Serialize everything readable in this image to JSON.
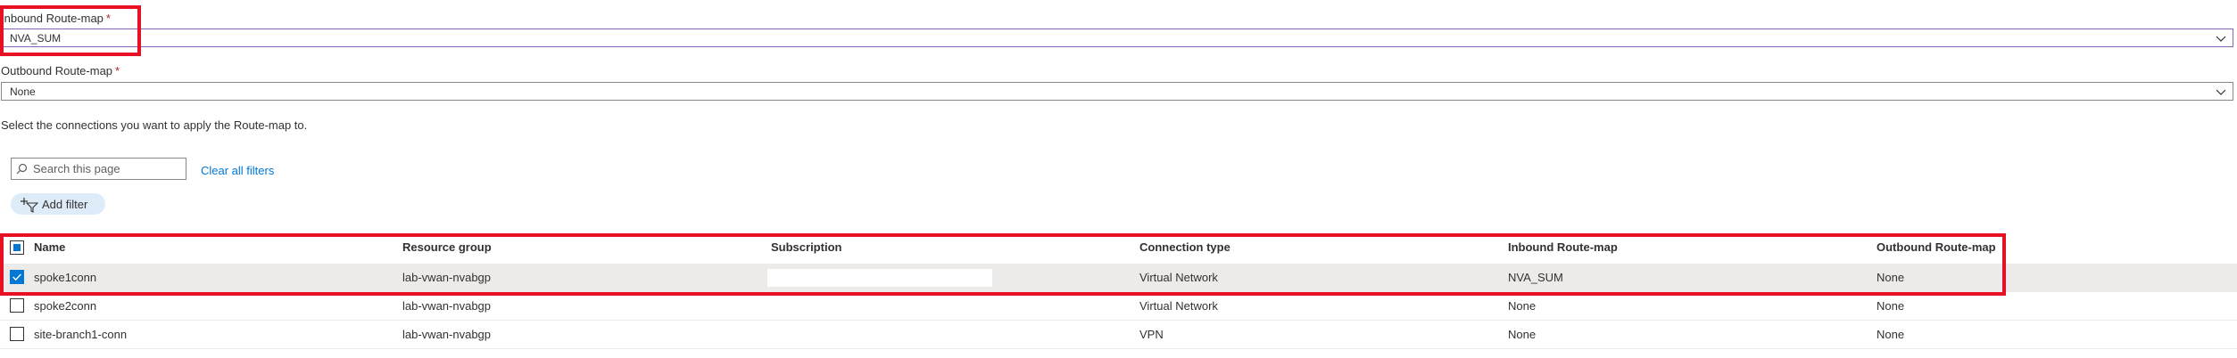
{
  "inbound": {
    "label": "Inbound Route-map",
    "required_mark": "*",
    "value": "NVA_SUM"
  },
  "outbound": {
    "label": "Outbound Route-map",
    "required_mark": "*",
    "value": "None"
  },
  "instructions": "Select the connections you want to apply the Route-map to.",
  "search": {
    "placeholder": "Search this page"
  },
  "clear_filters_label": "Clear all filters",
  "add_filter_label": "Add filter",
  "columns": [
    "Name",
    "Resource group",
    "Subscription",
    "Connection type",
    "Inbound Route-map",
    "Outbound Route-map"
  ],
  "rows": [
    {
      "selected": true,
      "name": "spoke1conn",
      "resource_group": "lab-vwan-nvabgp",
      "subscription": "",
      "connection_type": "Virtual Network",
      "inbound": "NVA_SUM",
      "outbound": "None"
    },
    {
      "selected": false,
      "name": "spoke2conn",
      "resource_group": "lab-vwan-nvabgp",
      "subscription": "",
      "connection_type": "Virtual Network",
      "inbound": "None",
      "outbound": "None"
    },
    {
      "selected": false,
      "name": "site-branch1-conn",
      "resource_group": "lab-vwan-nvabgp",
      "subscription": "",
      "connection_type": "VPN",
      "inbound": "None",
      "outbound": "None"
    }
  ],
  "colors": {
    "accent": "#0078d4",
    "highlight": "#e81123",
    "focus_border": "#8764b8",
    "selected_row": "#edebe9"
  }
}
